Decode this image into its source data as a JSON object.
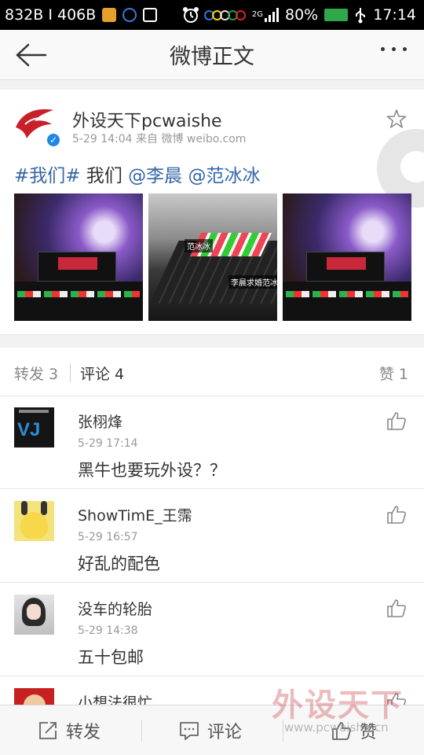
{
  "status_bar": {
    "network_speed": "832B I 406B",
    "signal_type": "2G",
    "battery": "80%",
    "time": "17:14"
  },
  "header": {
    "title": "微博正文"
  },
  "post": {
    "author": "外设天下pcwaishe",
    "meta": "5-29 14:04   来自 微博 weibo.com",
    "content": {
      "topic": "#我们#",
      "text": "我们",
      "mention1": "@李晨",
      "mention2": "@范冰冰"
    },
    "photos": [
      {
        "icon": "photo-keyboard-dragon"
      },
      {
        "icon": "photo-keyboard-closeup",
        "tag1": "范冰冰",
        "tag2": "李晨求婚范冰冰"
      },
      {
        "icon": "photo-keyboard-dragon"
      }
    ]
  },
  "tabs": {
    "repost": "转发 3",
    "comment": "评论 4",
    "like": "赞 1"
  },
  "comments": [
    {
      "name": "张栩烽",
      "time": "5-29 17:14",
      "text": "黑牛也要玩外设？？",
      "avatar_badge": "VJ"
    },
    {
      "name": "ShowTimE_王霈",
      "time": "5-29 16:57",
      "text": "好乱的配色"
    },
    {
      "name": "没车的轮胎",
      "time": "5-29 14:38",
      "text": "五十包邮"
    },
    {
      "name": "小想法很忙",
      "time": "",
      "text": ""
    }
  ],
  "bottom_bar": {
    "repost": "转发",
    "comment": "评论",
    "like": "赞"
  },
  "watermark": {
    "logo_text": "外设天下",
    "url": "www.pcwaishe.cn"
  },
  "colors": {
    "link": "#3566a6",
    "verified": "#1e88e5",
    "battery": "#2fa84a"
  }
}
